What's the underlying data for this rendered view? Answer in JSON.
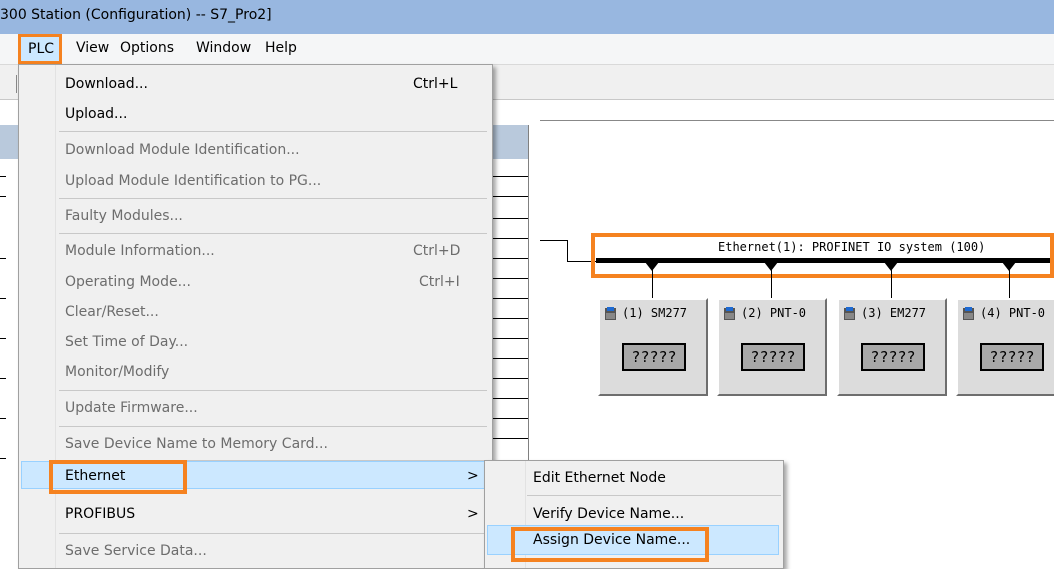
{
  "window": {
    "title": "300 Station (Configuration) -- S7_Pro2]"
  },
  "menubar": {
    "items": [
      "PLC",
      "View",
      "Options",
      "Window",
      "Help"
    ]
  },
  "plc_menu": {
    "items": [
      {
        "label": "Download...",
        "shortcut": "Ctrl+L",
        "enabled": true
      },
      {
        "label": "Upload...",
        "shortcut": "",
        "enabled": true
      },
      {
        "label": "Download Module Identification...",
        "shortcut": "",
        "enabled": false
      },
      {
        "label": "Upload Module Identification to PG...",
        "shortcut": "",
        "enabled": false
      },
      {
        "label": "Faulty Modules...",
        "shortcut": "",
        "enabled": false
      },
      {
        "label": "Module Information...",
        "shortcut": "Ctrl+D",
        "enabled": false
      },
      {
        "label": "Operating Mode...",
        "shortcut": "Ctrl+I",
        "enabled": false
      },
      {
        "label": "Clear/Reset...",
        "shortcut": "",
        "enabled": false
      },
      {
        "label": "Set Time of Day...",
        "shortcut": "",
        "enabled": false
      },
      {
        "label": "Monitor/Modify",
        "shortcut": "",
        "enabled": false
      },
      {
        "label": "Update Firmware...",
        "shortcut": "",
        "enabled": false
      },
      {
        "label": "Save Device Name to Memory Card...",
        "shortcut": "",
        "enabled": false
      },
      {
        "label": "Ethernet",
        "shortcut": "",
        "enabled": true,
        "submenu_arrow": ">"
      },
      {
        "label": "PROFIBUS",
        "shortcut": "",
        "enabled": true,
        "submenu_arrow": ">"
      },
      {
        "label": "Save Service Data...",
        "shortcut": "",
        "enabled": false
      }
    ]
  },
  "ethernet_submenu": {
    "items": [
      "Edit Ethernet Node",
      "Verify Device Name...",
      "Assign Device Name..."
    ]
  },
  "network": {
    "bus_label": "Ethernet(1): PROFINET IO system (100)",
    "devices": [
      {
        "title": "(1) SM277",
        "name": "?????"
      },
      {
        "title": "(2) PNT-0",
        "name": "?????"
      },
      {
        "title": "(3) EM277",
        "name": "?????"
      },
      {
        "title": "(4) PNT-0",
        "name": "?????"
      }
    ]
  },
  "colors": {
    "highlight_outline": "#f58220",
    "menu_selection": "#cce8ff",
    "titlebar": "#98b7e0"
  }
}
